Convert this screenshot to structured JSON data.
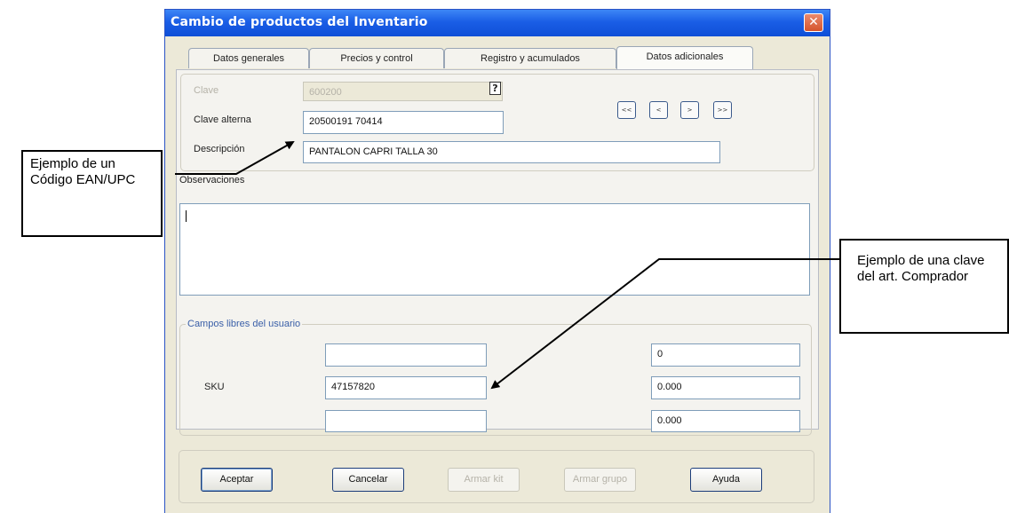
{
  "window": {
    "title": "Cambio de productos del Inventario",
    "close_symbol": "✕"
  },
  "tabs": [
    {
      "label": "Datos generales"
    },
    {
      "label": "Precios y control"
    },
    {
      "label": "Registro y acumulados"
    },
    {
      "label": "Datos adicionales"
    }
  ],
  "form": {
    "clave_label": "Clave",
    "clave_value": "600200",
    "clave_alterna_label": "Clave alterna",
    "clave_alterna_value": "20500191 70414",
    "descripcion_label": "Descripción",
    "descripcion_value": "PANTALON CAPRI TALLA 30",
    "observaciones_label": "Observaciones",
    "help_symbol": "?",
    "nav": [
      "<<",
      "<",
      ">",
      ">>"
    ]
  },
  "campos_libres": {
    "title": "Campos libres del usuario",
    "sku_label": "SKU",
    "left_fields": [
      "",
      "47157820",
      ""
    ],
    "right_fields": [
      "0",
      "0.000",
      "0.000"
    ]
  },
  "buttons": {
    "aceptar": "Aceptar",
    "cancelar": "Cancelar",
    "armar_kit": "Armar kit",
    "armar_grupo": "Armar grupo",
    "ayuda": "Ayuda"
  },
  "annotations": {
    "ean": "Ejemplo de un Código EAN/UPC",
    "clave_art": "Ejemplo de una clave del art. Comprador"
  }
}
